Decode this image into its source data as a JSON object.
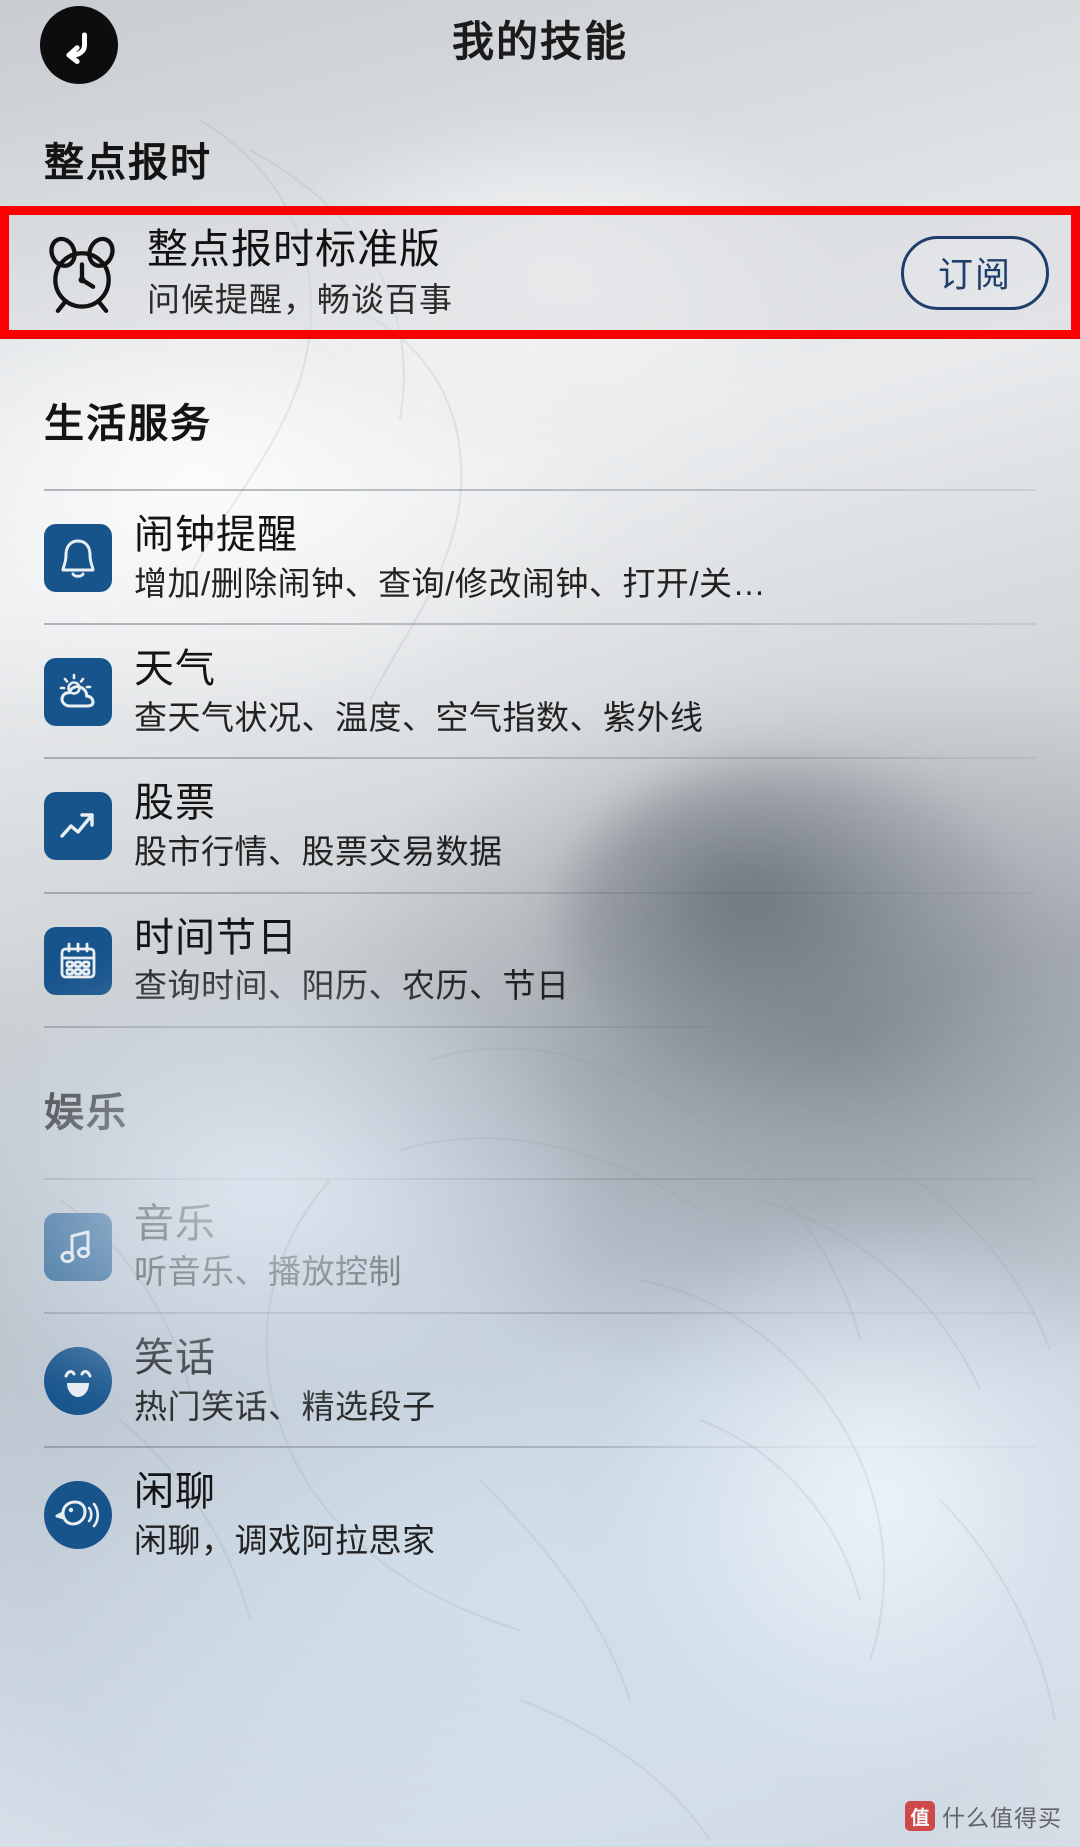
{
  "header": {
    "title": "我的技能",
    "back_icon": "back-arrow-icon"
  },
  "featured_section": {
    "title": "整点报时",
    "card": {
      "icon": "alarm-clock-icon",
      "title": "整点报时标准版",
      "subtitle": "问候提醒，畅谈百事",
      "action_label": "订阅",
      "highlight_color": "#fb0000",
      "accent_color": "#1f3f6b"
    }
  },
  "sections": [
    {
      "title": "生活服务",
      "items": [
        {
          "icon": "bell-icon",
          "title": "闹钟提醒",
          "subtitle": "增加/删除闹钟、查询/修改闹钟、打开/关…"
        },
        {
          "icon": "sun-cloud-icon",
          "title": "天气",
          "subtitle": "查天气状况、温度、空气指数、紫外线"
        },
        {
          "icon": "trending-up-icon",
          "title": "股票",
          "subtitle": "股市行情、股票交易数据"
        },
        {
          "icon": "calendar-icon",
          "title": "时间节日",
          "subtitle": "查询时间、阳历、农历、节日"
        }
      ]
    },
    {
      "title": "娱乐",
      "items": [
        {
          "icon": "music-note-icon",
          "title": "音乐",
          "subtitle": "听音乐、播放控制"
        },
        {
          "icon": "smiley-face-icon",
          "title": "笑话",
          "subtitle": "热门笑话、精选段子"
        },
        {
          "icon": "talking-bird-icon",
          "title": "闲聊",
          "subtitle": "闲聊，调戏阿拉思家"
        }
      ]
    }
  ],
  "watermark": {
    "badge": "值",
    "text": "什么值得买"
  },
  "theme": {
    "icon_tile_color": "#17548c",
    "title_color": "#141414"
  }
}
